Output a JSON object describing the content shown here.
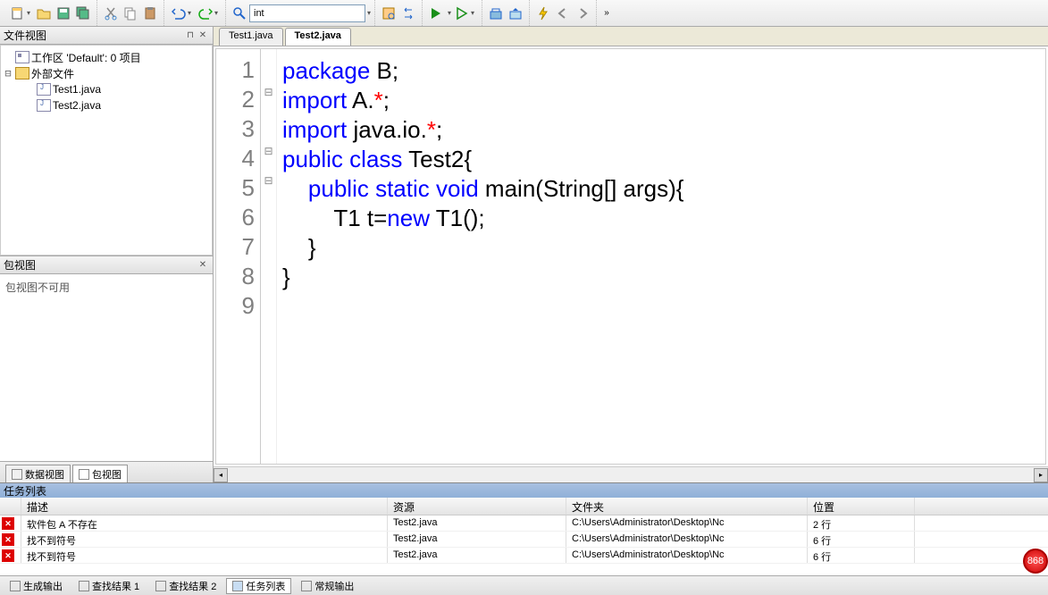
{
  "toolbar": {
    "search_value": "int"
  },
  "left_panel": {
    "file_view_title": "文件视图",
    "workspace_label": "工作区 'Default': 0 项目",
    "ext_files_label": "外部文件",
    "files": [
      "Test1.java",
      "Test2.java"
    ],
    "pkg_view_title": "包视图",
    "pkg_unavailable": "包视图不可用",
    "tabs": {
      "data_view": "数据视图",
      "pkg_view": "包视图"
    }
  },
  "editor": {
    "tabs": [
      {
        "label": "Test1.java",
        "active": false
      },
      {
        "label": "Test2.java",
        "active": true
      }
    ],
    "line_numbers": [
      "1",
      "2",
      "3",
      "4",
      "5",
      "6",
      "7",
      "8",
      "9"
    ],
    "code_lines": [
      [
        {
          "t": "package",
          "c": "kw"
        },
        {
          "t": " B;",
          "c": "plain"
        }
      ],
      [
        {
          "t": "import",
          "c": "kw"
        },
        {
          "t": " A.",
          "c": "plain"
        },
        {
          "t": "*",
          "c": "star"
        },
        {
          "t": ";",
          "c": "plain"
        }
      ],
      [
        {
          "t": "import",
          "c": "kw"
        },
        {
          "t": " java.io.",
          "c": "plain"
        },
        {
          "t": "*",
          "c": "star"
        },
        {
          "t": ";",
          "c": "plain"
        }
      ],
      [
        {
          "t": "public",
          "c": "kw"
        },
        {
          "t": " ",
          "c": "plain"
        },
        {
          "t": "class",
          "c": "kw"
        },
        {
          "t": " Test2{",
          "c": "plain"
        }
      ],
      [
        {
          "t": "    ",
          "c": "plain"
        },
        {
          "t": "public",
          "c": "kw"
        },
        {
          "t": " ",
          "c": "plain"
        },
        {
          "t": "static",
          "c": "kw"
        },
        {
          "t": " ",
          "c": "plain"
        },
        {
          "t": "void",
          "c": "kw"
        },
        {
          "t": " main(String[] args){",
          "c": "plain"
        }
      ],
      [
        {
          "t": "        T1 t=",
          "c": "plain"
        },
        {
          "t": "new",
          "c": "kw"
        },
        {
          "t": " T1();",
          "c": "plain"
        }
      ],
      [
        {
          "t": "    }",
          "c": "plain"
        }
      ],
      [
        {
          "t": "}",
          "c": "plain"
        }
      ],
      [
        {
          "t": "",
          "c": "plain"
        }
      ]
    ],
    "fold_marks": [
      "",
      "⊟",
      "",
      "⊟",
      "⊟",
      "",
      "",
      "",
      ""
    ]
  },
  "tasks": {
    "title": "任务列表",
    "columns": {
      "desc": "描述",
      "res": "资源",
      "folder": "文件夹",
      "pos": "位置"
    },
    "rows": [
      {
        "desc": "软件包 A 不存在",
        "res": "Test2.java",
        "folder": "C:\\Users\\Administrator\\Desktop\\Nc",
        "pos": "2 行"
      },
      {
        "desc": "找不到符号",
        "res": "Test2.java",
        "folder": "C:\\Users\\Administrator\\Desktop\\Nc",
        "pos": "6 行"
      },
      {
        "desc": "找不到符号",
        "res": "Test2.java",
        "folder": "C:\\Users\\Administrator\\Desktop\\Nc",
        "pos": "6 行"
      }
    ]
  },
  "bottom_tabs": {
    "build_output": "生成输出",
    "find_1": "查找结果 1",
    "find_2": "查找结果 2",
    "task_list": "任务列表",
    "console": "常规输出"
  },
  "badge": "868"
}
